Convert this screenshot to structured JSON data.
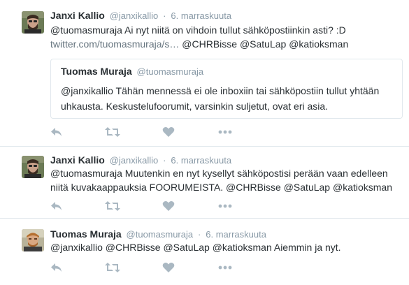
{
  "tweets": [
    {
      "fullname": "Janxi Kallio",
      "username": "@janxikallio",
      "separator": "·",
      "time": "6. marraskuuta",
      "text_line1": "@tuomasmuraja Ai nyt niitä on vihdoin tullut sähköpostiinkin asti? :D",
      "link": "twitter.com/tuomasmuraja/s…",
      "text_line2_rest": "@CHRBisse @SatuLap @katioksman",
      "quoted": {
        "fullname": "Tuomas Muraja",
        "username": "@tuomasmuraja",
        "text": "@janxikallio Tähän mennessä ei ole inboxiin tai sähköpostiin tullut yhtään uhkausta. Keskustelufoorumit, varsinkin suljetut, ovat eri asia."
      }
    },
    {
      "fullname": "Janxi Kallio",
      "username": "@janxikallio",
      "separator": "·",
      "time": "6. marraskuuta",
      "text_line1": "@tuomasmuraja Muutenkin en nyt kysellyt sähköpostisi perään vaan edelleen",
      "text_line2": "niitä kuvakaappauksia FOORUMEISTA. @CHRBisse @SatuLap @katioksman"
    },
    {
      "fullname": "Tuomas Muraja",
      "username": "@tuomasmuraja",
      "separator": "·",
      "time": "6. marraskuuta",
      "text_line1": "@janxikallio @CHRBisse @SatuLap @katioksman Aiemmin ja nyt."
    }
  ],
  "icons": {
    "reply": "reply-icon",
    "retweet": "retweet-icon",
    "like": "heart-icon",
    "more": "more-icon"
  },
  "colors": {
    "icon": "#aab8c2",
    "meta": "#8899a6",
    "text": "#292f33",
    "border": "#e1e8ed"
  }
}
